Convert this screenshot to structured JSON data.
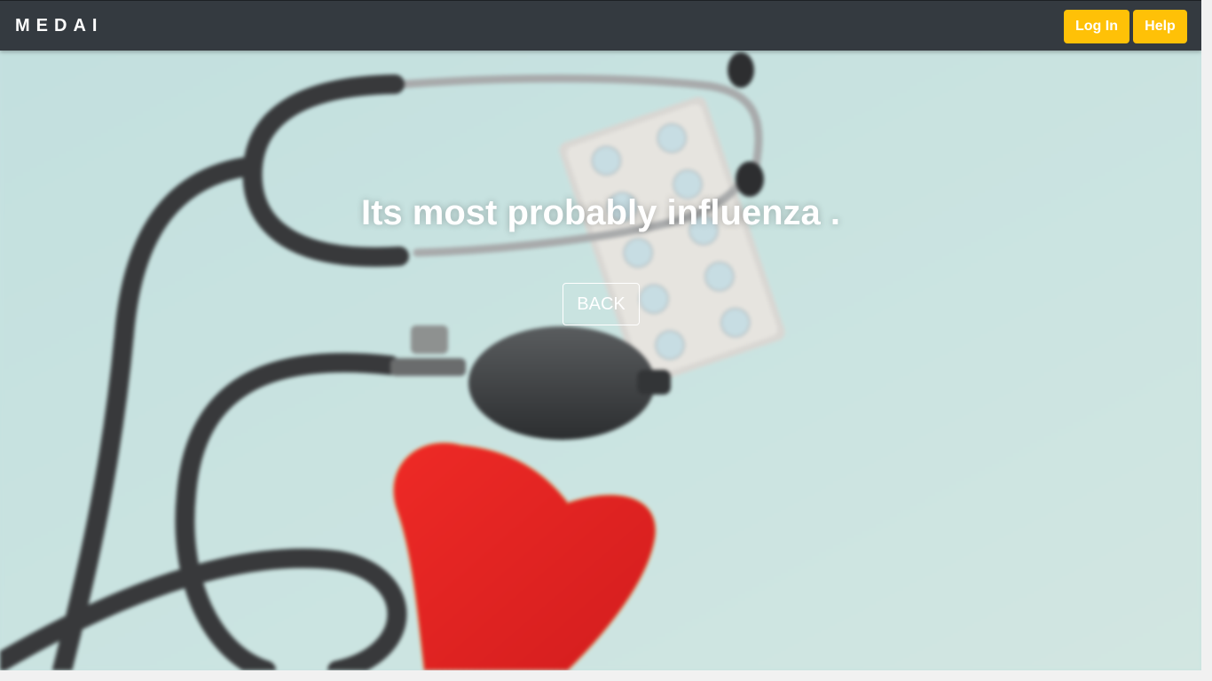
{
  "brand": "MEDAI",
  "nav": {
    "login_label": "Log In",
    "help_label": "Help"
  },
  "hero": {
    "headline": "Its most probably influenza .",
    "back_label": "BACK",
    "background_image": "stethoscope-pills-heart-photo"
  },
  "colors": {
    "navbar": "#343a40",
    "accent": "#ffc107",
    "hero_bg": "#c7e2e0"
  }
}
